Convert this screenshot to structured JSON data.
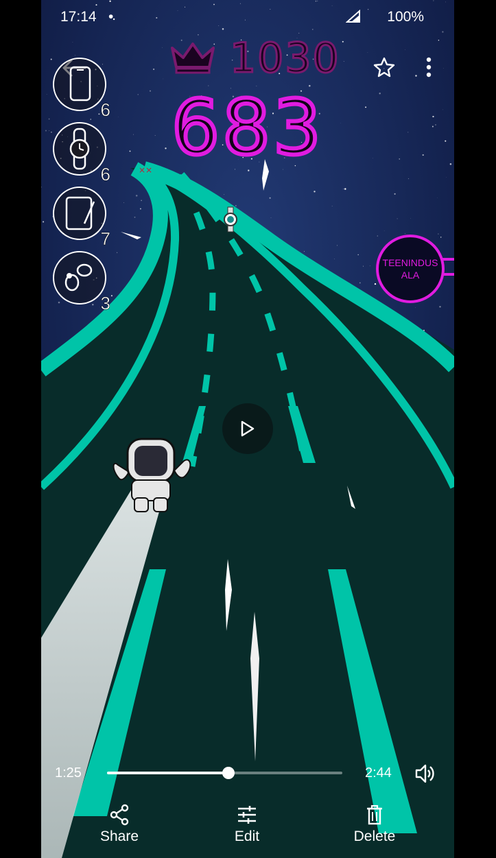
{
  "status_bar": {
    "time": "17:14",
    "dot": "•",
    "battery": "100%"
  },
  "game": {
    "high_score": "1030",
    "score": "683",
    "items": [
      {
        "icon": "phone-icon",
        "count": "6"
      },
      {
        "icon": "watch-icon",
        "count": "6"
      },
      {
        "icon": "tablet-icon",
        "count": "7"
      },
      {
        "icon": "earbuds-icon",
        "count": "3"
      }
    ],
    "sign_label": "TEENINDUS ALA"
  },
  "player": {
    "current_time": "1:25",
    "total_time": "2:44",
    "progress": 0.517
  },
  "actions": {
    "share": "Share",
    "edit": "Edit",
    "delete": "Delete"
  },
  "colors": {
    "track": "#00c4a8",
    "road": "#082c2a",
    "neon": "#e01ce0",
    "sky": "#142350"
  }
}
